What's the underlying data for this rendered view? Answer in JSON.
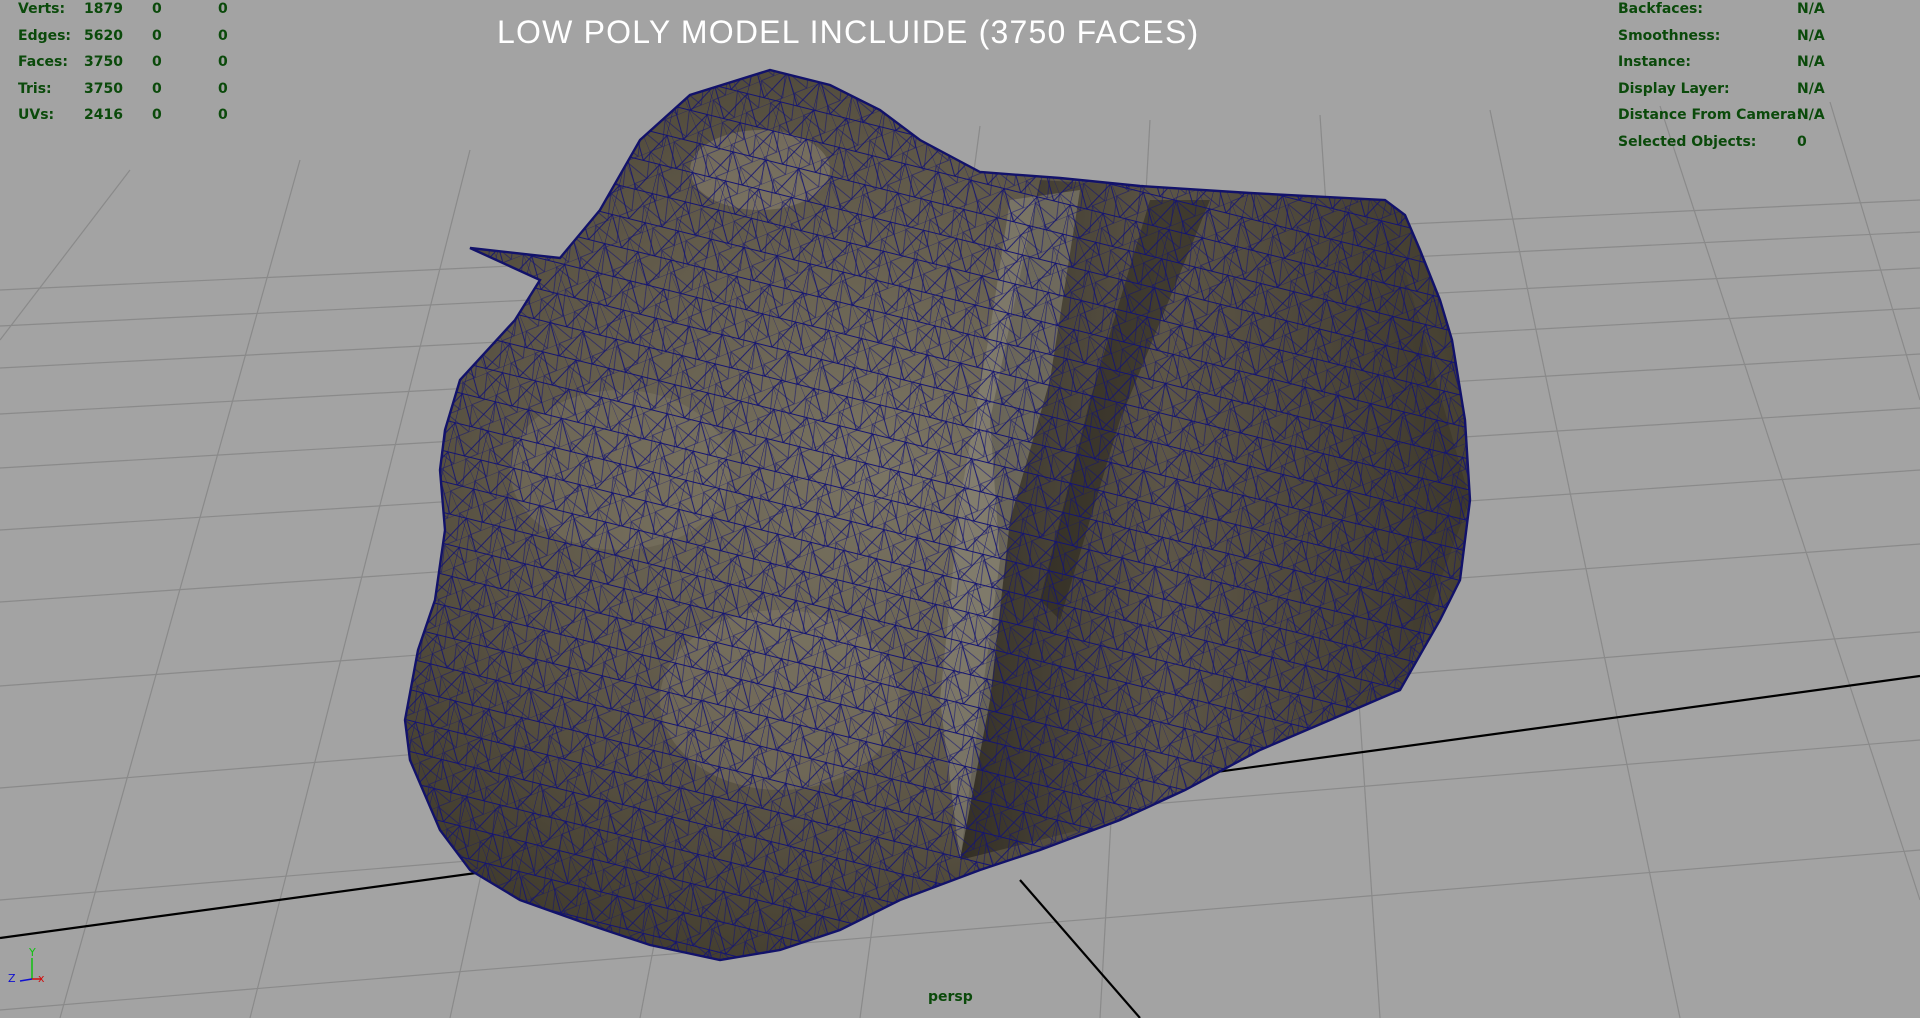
{
  "viewport": {
    "overlay_title": "LOW POLY MODEL INCLUIDE (3750 FACES)",
    "camera_name": "persp",
    "background_color": "#a3a3a3"
  },
  "heads_up_left": {
    "rows": [
      {
        "label": "Verts:",
        "values": [
          "1879",
          "0",
          "0"
        ]
      },
      {
        "label": "Edges:",
        "values": [
          "5620",
          "0",
          "0"
        ]
      },
      {
        "label": "Faces:",
        "values": [
          "3750",
          "0",
          "0"
        ]
      },
      {
        "label": "Tris:",
        "values": [
          "3750",
          "0",
          "0"
        ]
      },
      {
        "label": "UVs:",
        "values": [
          "2416",
          "0",
          "0"
        ]
      }
    ]
  },
  "heads_up_right": {
    "rows": [
      {
        "label": "Backfaces:",
        "value": "N/A"
      },
      {
        "label": "Smoothness:",
        "value": "N/A"
      },
      {
        "label": "Instance:",
        "value": "N/A"
      },
      {
        "label": "Display Layer:",
        "value": "N/A"
      },
      {
        "label": "Distance From Camera:",
        "value": "N/A"
      },
      {
        "label": "Selected Objects:",
        "value": "0"
      }
    ]
  },
  "axis_gizmo": {
    "x_label": "x",
    "y_label": "Y",
    "z_label": "Z",
    "x_color": "#d01010",
    "y_color": "#10c010",
    "z_color": "#1010d0"
  },
  "colors": {
    "hud_text": "#0b4a0b",
    "grid_line": "#8a8a8a",
    "grid_axis": "#000000",
    "wireframe": "#101070"
  }
}
